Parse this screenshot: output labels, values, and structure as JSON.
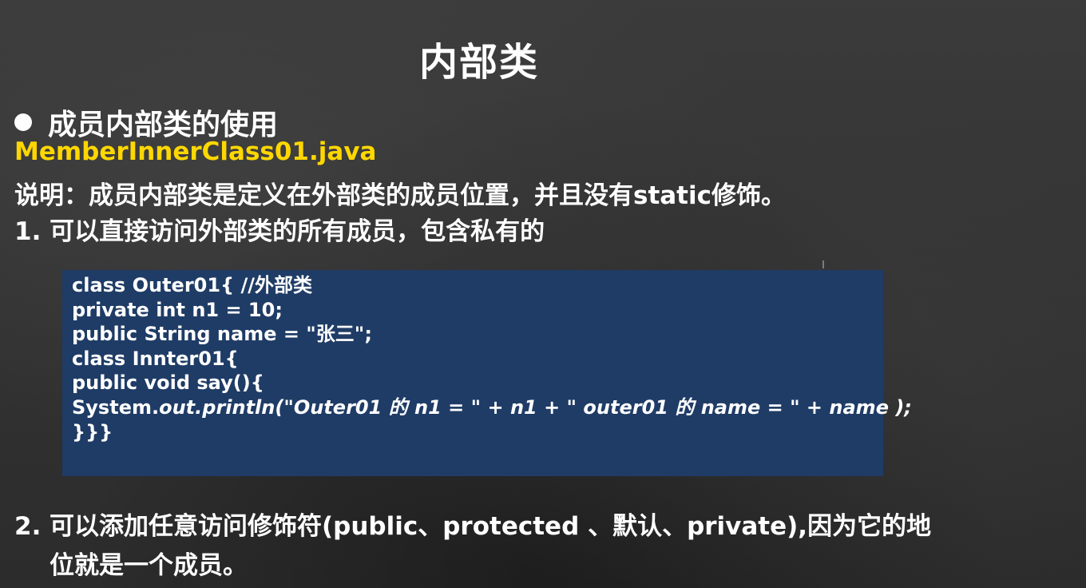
{
  "slide": {
    "title": "内部类",
    "bullet": "成员内部类的使用",
    "filename": "MemberInnerClass01.java",
    "description": "说明：成员内部类是定义在外部类的成员位置，并且没有static修饰。",
    "point1": "1. 可以直接访问外部类的所有成员，包含私有的",
    "code": {
      "line1": "class Outer01{ //外部类",
      "line2": "private int n1 = 10;",
      "line3": "public String name = \"张三\";",
      "line4": "class Innter01{",
      "line5": "public void say(){",
      "line6_prefix": "System.",
      "line6_italic": "out.println(\"Outer01 的 n1 = \" + n1 + \" outer01 的 name = \" + name );",
      "line7": "}}}"
    },
    "point2": {
      "number": "2.",
      "line1": "可以添加任意访问修饰符(public、protected 、默认、private),因为它的地",
      "line2": "位就是一个成员。"
    }
  },
  "colors": {
    "background": "#333333",
    "filename": "#ffd700",
    "code_background": "#1f3c66",
    "text": "#ffffff"
  }
}
